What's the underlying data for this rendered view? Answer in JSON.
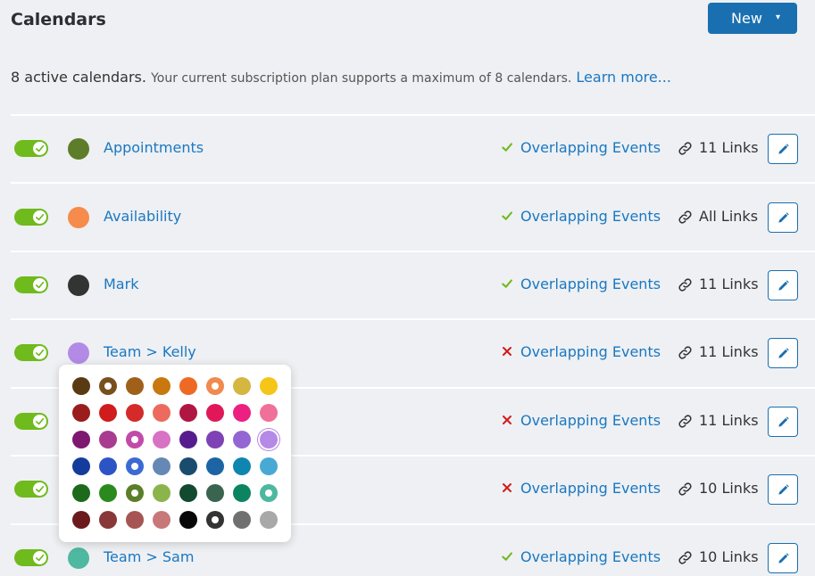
{
  "header": {
    "title": "Calendars",
    "new_button": "New",
    "caret": "▾"
  },
  "info": {
    "active": "8 active calendars.",
    "plan": "Your current subscription plan supports a maximum of 8 calendars.",
    "learn_more": "Learn more..."
  },
  "calendars": [
    {
      "name": "Appointments",
      "color": "#5e7d2a",
      "overlap": "Overlapping Events",
      "overlap_allowed": true,
      "links": "11 Links",
      "enabled": true
    },
    {
      "name": "Availability",
      "color": "#f68b4c",
      "overlap": "Overlapping Events",
      "overlap_allowed": true,
      "links": "All Links",
      "enabled": true
    },
    {
      "name": "Mark",
      "color": "#333333",
      "overlap": "Overlapping Events",
      "overlap_allowed": true,
      "links": "11 Links",
      "enabled": true
    },
    {
      "name": "Team > Kelly",
      "color": "#b38be6",
      "overlap": "Overlapping Events",
      "overlap_allowed": false,
      "links": "11 Links",
      "enabled": true
    },
    {
      "name": "",
      "color": "",
      "overlap": "Overlapping Events",
      "overlap_allowed": false,
      "links": "11 Links",
      "enabled": true
    },
    {
      "name": "",
      "color": "",
      "overlap": "Overlapping Events",
      "overlap_allowed": false,
      "links": "10 Links",
      "enabled": true
    },
    {
      "name": "Team > Sam",
      "color": "#4fb8a0",
      "overlap": "Overlapping Events",
      "overlap_allowed": true,
      "links": "10 Links",
      "enabled": true
    }
  ],
  "color_picker": {
    "rows": [
      [
        {
          "c": "#5a3a12"
        },
        {
          "c": "#7a4f1e",
          "sel": true
        },
        {
          "c": "#a0601a"
        },
        {
          "c": "#c8780e"
        },
        {
          "c": "#ee6a24"
        },
        {
          "c": "#f08a4e",
          "sel": true
        },
        {
          "c": "#d4b640"
        },
        {
          "c": "#f5c518"
        }
      ],
      [
        {
          "c": "#9b1c1c"
        },
        {
          "c": "#d01c1c"
        },
        {
          "c": "#d42a2a"
        },
        {
          "c": "#ec6a5e"
        },
        {
          "c": "#b01642"
        },
        {
          "c": "#e0185a"
        },
        {
          "c": "#ec2080"
        },
        {
          "c": "#f07099"
        }
      ],
      [
        {
          "c": "#7e1870"
        },
        {
          "c": "#a83c90"
        },
        {
          "c": "#c24aa8",
          "sel": true
        },
        {
          "c": "#d872c4"
        },
        {
          "c": "#561c8e"
        },
        {
          "c": "#7e42b4"
        },
        {
          "c": "#9466d4"
        },
        {
          "c": "#b48ae6",
          "ring": true
        }
      ],
      [
        {
          "c": "#143c9c"
        },
        {
          "c": "#2c54c4"
        },
        {
          "c": "#3c6ad4",
          "sel": true
        },
        {
          "c": "#6688b4"
        },
        {
          "c": "#1a4c6e"
        },
        {
          "c": "#1c64a4"
        },
        {
          "c": "#0e86b0"
        },
        {
          "c": "#48aad4"
        }
      ],
      [
        {
          "c": "#1c6a1c"
        },
        {
          "c": "#2a8a1e"
        },
        {
          "c": "#5a7e2a",
          "sel": true
        },
        {
          "c": "#8cb44c"
        },
        {
          "c": "#124a30"
        },
        {
          "c": "#3a6450"
        },
        {
          "c": "#0c8462"
        },
        {
          "c": "#4cb8a0",
          "sel": true
        }
      ],
      [
        {
          "c": "#6a1a1a"
        },
        {
          "c": "#883838"
        },
        {
          "c": "#a65454"
        },
        {
          "c": "#c87878"
        },
        {
          "c": "#080808"
        },
        {
          "c": "#333333",
          "sel": true
        },
        {
          "c": "#707070"
        },
        {
          "c": "#a8a8a8"
        }
      ]
    ]
  },
  "colors": {
    "accent": "#1a6fb0",
    "link": "#1a78c2",
    "toggle_on": "#6fba1c",
    "check": "#6fba1c",
    "cross": "#d01c1c"
  },
  "icons": {
    "check": "check-icon",
    "cross": "cross-icon",
    "link": "link-icon",
    "edit": "pencil-icon"
  }
}
